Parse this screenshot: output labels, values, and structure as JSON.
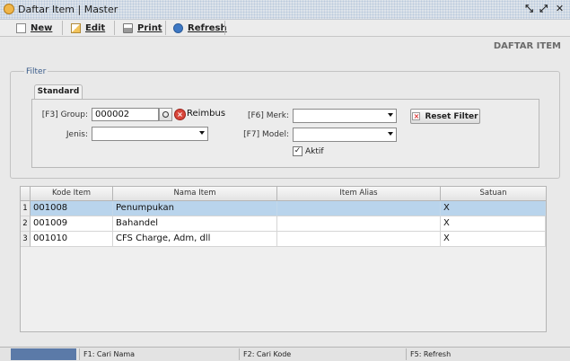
{
  "window": {
    "title": "Daftar Item | Master"
  },
  "toolbar": {
    "new_label": "New",
    "edit_label": "Edit",
    "print_label": "Print",
    "refresh_label": "Refresh"
  },
  "page": {
    "title": "DAFTAR ITEM"
  },
  "filter": {
    "legend": "Filter",
    "tab_label": "Standard",
    "group_label": "[F3] Group:",
    "group_value": "000002",
    "group_name": "Reimbus",
    "jenis_label": "Jenis:",
    "jenis_value": "",
    "merk_label": "[F6] Merk:",
    "merk_value": "",
    "model_label": "[F7] Model:",
    "model_value": "",
    "aktif_label": "Aktif",
    "aktif_checked": true,
    "reset_label": "Reset Filter"
  },
  "grid": {
    "columns": [
      "Kode Item",
      "Nama Item",
      "Item Alias",
      "Satuan"
    ],
    "rows": [
      {
        "num": "1",
        "kode": "001008",
        "nama": "Penumpukan",
        "alias": "",
        "satuan": "X",
        "selected": true
      },
      {
        "num": "2",
        "kode": "001009",
        "nama": "Bahandel",
        "alias": "",
        "satuan": "X",
        "selected": false
      },
      {
        "num": "3",
        "kode": "001010",
        "nama": "CFS Charge, Adm, dll",
        "alias": "",
        "satuan": "X",
        "selected": false
      }
    ]
  },
  "statusbar": {
    "f1": "F1: Cari Nama",
    "f2": "F2: Cari Kode",
    "f5": "F5: Refresh"
  },
  "colors": {
    "selected_row": "#b9d4ec",
    "status_accent": "#5b7aa8",
    "legend": "#3a5b8a"
  }
}
